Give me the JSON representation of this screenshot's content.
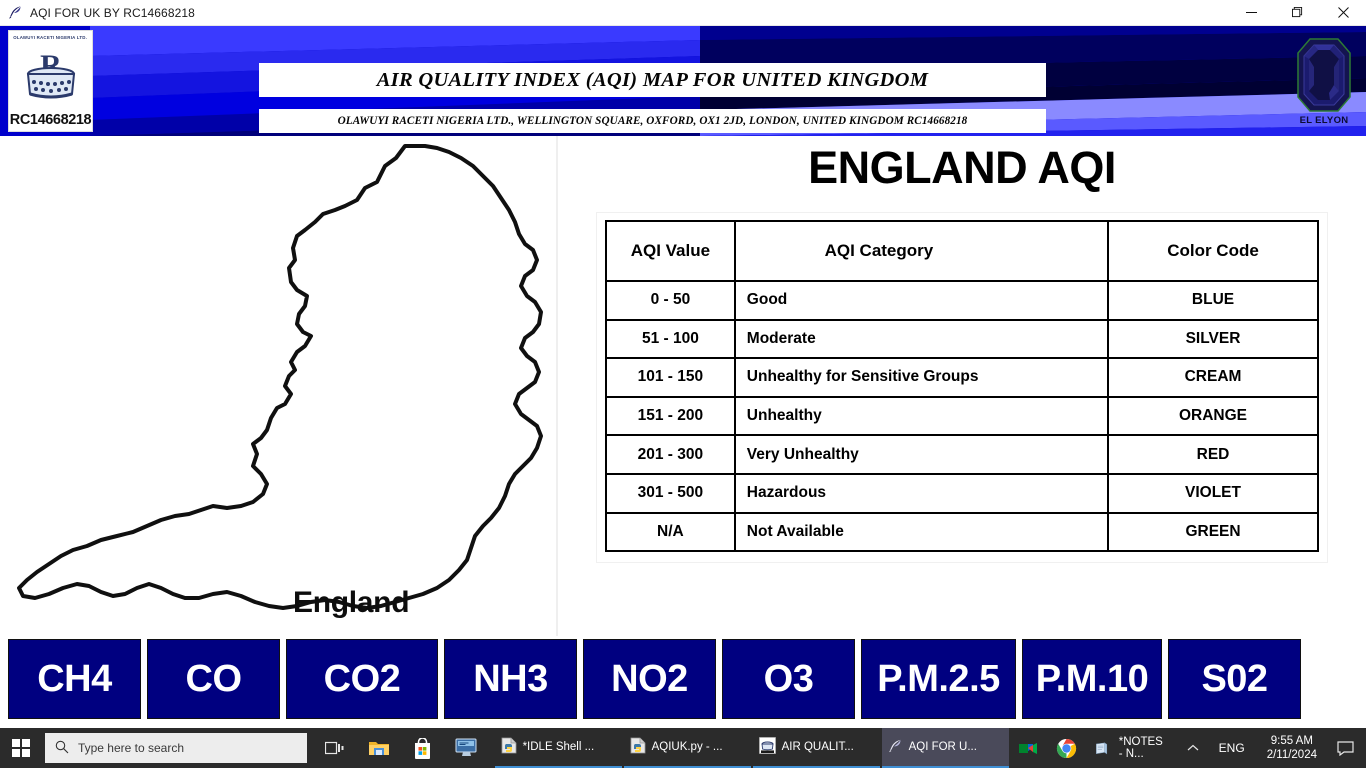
{
  "window": {
    "title": "AQI FOR UK BY RC14668218",
    "app_icon": "feather-quill-icon",
    "minimize_label": "—",
    "maximize_label": "❐",
    "close_label": "✕"
  },
  "banner": {
    "title": "AIR QUALITY INDEX (AQI) MAP FOR UNITED KINGDOM",
    "subtitle": "OLAWUYI RACETI NIGERIA LTD., WELLINGTON SQUARE, OXFORD, OX1 2JD, LONDON, UNITED KINGDOM RC14668218",
    "logo_left": {
      "company_text": "OLAWUYI RACETI NIGERIA LTD.",
      "reg_number": "RC14668218",
      "icon": "company-monogram-icon"
    },
    "logo_right": {
      "name": "EL ELYON",
      "icon": "gemstone-icon"
    },
    "colors": {
      "blue_light": "#3a3aff",
      "blue_mid": "#1a1ae6",
      "blue_deep": "#0000cc",
      "navy": "#000080",
      "navy_dark": "#00004d",
      "periwinkle": "#8a8aff"
    }
  },
  "map": {
    "label": "England",
    "region_name": "England"
  },
  "panel": {
    "title": "ENGLAND AQI"
  },
  "table": {
    "headers": [
      "AQI Value",
      "AQI Category",
      "Color Code"
    ],
    "rows": [
      {
        "value": "0 - 50",
        "category": "Good",
        "color_code": "BLUE"
      },
      {
        "value": "51 - 100",
        "category": "Moderate",
        "color_code": "SILVER"
      },
      {
        "value": "101 - 150",
        "category": "Unhealthy for Sensitive Groups",
        "color_code": "CREAM"
      },
      {
        "value": "151 - 200",
        "category": "Unhealthy",
        "color_code": "ORANGE"
      },
      {
        "value": "201 - 300",
        "category": "Very Unhealthy",
        "color_code": "RED"
      },
      {
        "value": "301 - 500",
        "category": "Hazardous",
        "color_code": "VIOLET"
      },
      {
        "value": "N/A",
        "category": "Not Available",
        "color_code": "GREEN"
      }
    ]
  },
  "buttons": {
    "color": "#000080",
    "items": [
      {
        "label": "CH4",
        "width": 133
      },
      {
        "label": "CO",
        "width": 133
      },
      {
        "label": "CO2",
        "width": 152
      },
      {
        "label": "NH3",
        "width": 133
      },
      {
        "label": "NO2",
        "width": 133
      },
      {
        "label": "O3",
        "width": 133
      },
      {
        "label": "P.M.2.5",
        "width": 155
      },
      {
        "label": "P.M.10",
        "width": 140
      },
      {
        "label": "S02",
        "width": 133
      }
    ]
  },
  "taskbar": {
    "start_icon": "windows-start-icon",
    "search_placeholder": "Type here to search",
    "search_icon": "search-icon",
    "pinned": [
      {
        "name": "task-view-icon",
        "label": "Task View"
      },
      {
        "name": "file-explorer-icon",
        "label": "File Explorer"
      },
      {
        "name": "microsoft-store-icon",
        "label": "Microsoft Store"
      },
      {
        "name": "remote-desktop-icon",
        "label": "Remote Desktop"
      }
    ],
    "windows": [
      {
        "label": "*IDLE Shell ...",
        "icon": "python-file-icon",
        "active": false
      },
      {
        "label": "AQIUK.py - ...",
        "icon": "python-file-icon",
        "active": false
      },
      {
        "label": "AIR QUALIT...",
        "icon": "company-logo-icon",
        "active": false
      },
      {
        "label": "AQI FOR U...",
        "icon": "feather-quill-icon",
        "active": true
      }
    ],
    "tray": [
      {
        "name": "google-meet-icon"
      },
      {
        "name": "google-chrome-icon"
      },
      {
        "name": "notepad-icon",
        "label": "*NOTES - N..."
      }
    ],
    "show_hidden_icon": "chevron-up-icon",
    "language": "ENG",
    "time": "9:55 AM",
    "date": "2/11/2024",
    "notification_icon": "notification-icon"
  }
}
